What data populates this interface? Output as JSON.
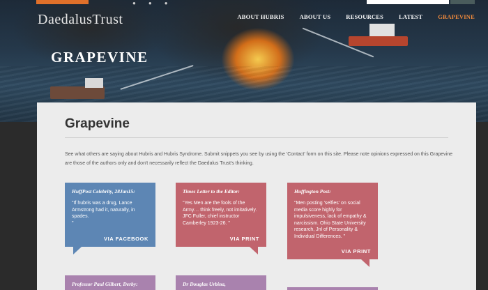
{
  "site": {
    "logo": "DaedalusTrust"
  },
  "nav": [
    {
      "label": "ABOUT HUBRIS"
    },
    {
      "label": "ABOUT US"
    },
    {
      "label": "RESOURCES"
    },
    {
      "label": "LATEST"
    },
    {
      "label": "GRAPEVINE"
    }
  ],
  "hero": {
    "title": "GRAPEVINE"
  },
  "page": {
    "title": "Grapevine",
    "intro": "See what others are saying about Hubris and Hubris Syndrome. Submit snippets you see by using the 'Contact' form on this site. Please note opinions expressed on this Grapevine are those of the authors only and don't necessarily reflect the Daedalus Trust's thinking."
  },
  "quotes": [
    {
      "source": "HuffPost Celebrity, 28Jan15:",
      "text": "\"If hubris was a drug, Lance Armstrong had it, naturally, in spades.\n\"",
      "via": "VIA FACEBOOK"
    },
    {
      "source": "Times Letter to the Editor:",
      "text": "\"Yes Men are the fools of the Army… think freely, not imitatively. JFC Fuller, chief instructor Camberley 1923-26. \"",
      "via": "VIA PRINT"
    },
    {
      "source": "Huffington Post:",
      "text": "\"Men posting 'selfies' on social media score highly for impulsiveness, lack of empathy & narcissism. Ohio State University research, Jnl of Personality & Individual Differences. \"",
      "via": "VIA PRINT"
    },
    {
      "source": "Professor Paul Gilbert, Derby:",
      "text": "",
      "via": ""
    },
    {
      "source": "Dr Douglas Urbina,",
      "text": "",
      "via": ""
    },
    {
      "source": "",
      "text": "",
      "via": ""
    }
  ],
  "colors": {
    "facebook_card": "#5d86b4",
    "print_card": "#c1646d",
    "purple_card": "#a982ae",
    "accent": "#e0702a"
  }
}
